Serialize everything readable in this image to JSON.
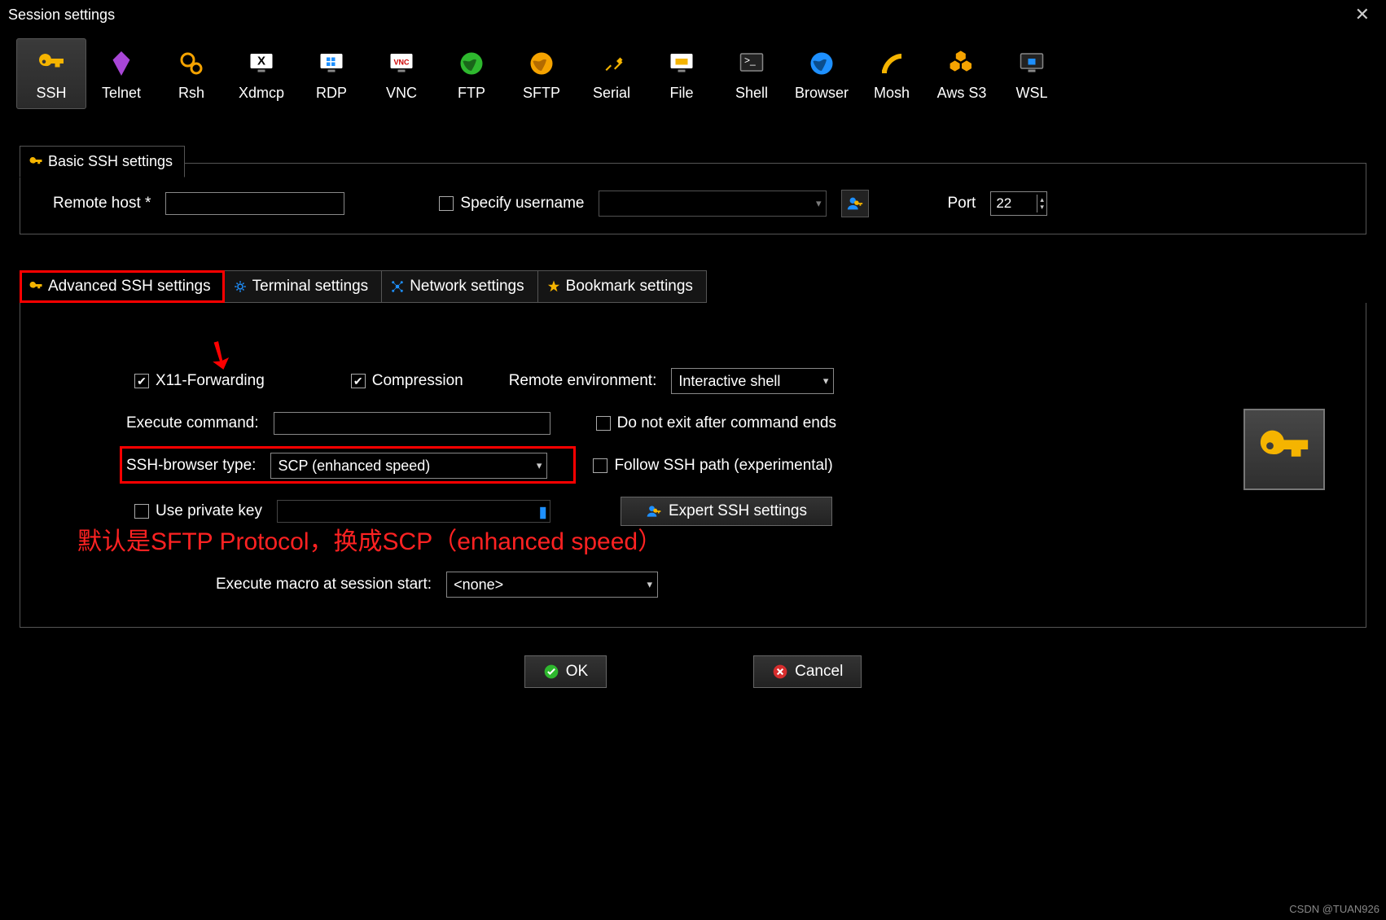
{
  "title": "Session settings",
  "session_types": [
    {
      "id": "ssh",
      "label": "SSH",
      "selected": true
    },
    {
      "id": "telnet",
      "label": "Telnet"
    },
    {
      "id": "rsh",
      "label": "Rsh"
    },
    {
      "id": "xdmcp",
      "label": "Xdmcp"
    },
    {
      "id": "rdp",
      "label": "RDP"
    },
    {
      "id": "vnc",
      "label": "VNC"
    },
    {
      "id": "ftp",
      "label": "FTP"
    },
    {
      "id": "sftp",
      "label": "SFTP"
    },
    {
      "id": "serial",
      "label": "Serial"
    },
    {
      "id": "file",
      "label": "File"
    },
    {
      "id": "shell",
      "label": "Shell"
    },
    {
      "id": "browser",
      "label": "Browser"
    },
    {
      "id": "mosh",
      "label": "Mosh"
    },
    {
      "id": "aws",
      "label": "Aws S3"
    },
    {
      "id": "wsl",
      "label": "WSL"
    }
  ],
  "basic": {
    "tab_label": "Basic SSH settings",
    "remote_host_label": "Remote host *",
    "remote_host_value": "",
    "specify_username_label": "Specify username",
    "specify_username_checked": false,
    "username_value": "",
    "port_label": "Port",
    "port_value": "22"
  },
  "tabs": {
    "advanced": "Advanced SSH settings",
    "terminal": "Terminal settings",
    "network": "Network settings",
    "bookmark": "Bookmark settings"
  },
  "advanced": {
    "x11_label": "X11-Forwarding",
    "x11_checked": true,
    "compression_label": "Compression",
    "compression_checked": true,
    "remote_env_label": "Remote environment:",
    "remote_env_value": "Interactive shell",
    "exec_cmd_label": "Execute command:",
    "exec_cmd_value": "",
    "no_exit_label": "Do not exit after command ends",
    "no_exit_checked": false,
    "ssh_browser_label": "SSH-browser type:",
    "ssh_browser_value": "SCP (enhanced speed)",
    "follow_path_label": "Follow SSH path (experimental)",
    "follow_path_checked": false,
    "use_privkey_label": "Use private key",
    "use_privkey_checked": false,
    "privkey_path": "",
    "expert_btn": "Expert SSH settings",
    "macro_label": "Execute macro at session start:",
    "macro_value": "<none>"
  },
  "annotation": "默认是SFTP Protocol，换成SCP（enhanced speed）",
  "buttons": {
    "ok": "OK",
    "cancel": "Cancel"
  },
  "watermark": "CSDN @TUAN926"
}
